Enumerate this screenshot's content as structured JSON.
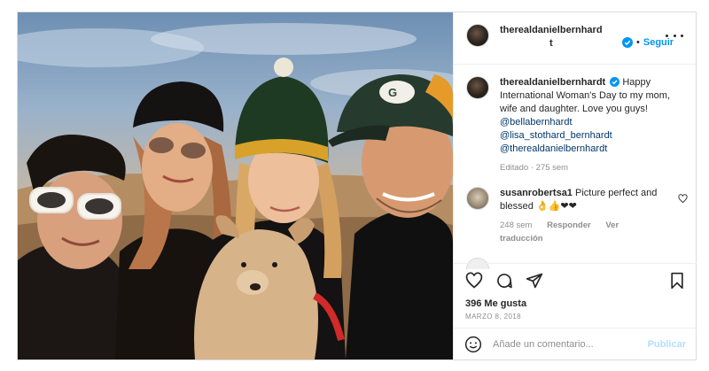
{
  "post": {
    "author": "therealdanielbernhardt",
    "author_wrapped_line1": "therealdanielbernhard",
    "author_wrapped_line2": "t",
    "follow_label": "Seguir",
    "dot": "•"
  },
  "caption": {
    "author": "therealdanielbernhardt",
    "text": " Happy International Woman's Day to my mom, wife and daughter. Love you guys! ",
    "mentions": [
      "@bellabernhardt",
      "@lisa_stothard_bernhardt",
      "@therealdanielbernhardt"
    ],
    "meta": "Editado · 275 sem"
  },
  "comment": {
    "author": "susanrobertsa1",
    "text": " Picture perfect and blessed 👌👍❤❤",
    "time": "248 sem",
    "reply_label": "Responder",
    "translate_label": "Ver traducción"
  },
  "stats": {
    "likes": "396 Me gusta",
    "date": "MARZO 8, 2018"
  },
  "add_comment": {
    "placeholder": "Añade un comentario...",
    "publish_label": "Publicar"
  },
  "icons": {
    "verified": "verified-badge-icon",
    "more": "more-options-icon",
    "like": "heart-icon",
    "comment": "comment-bubble-icon",
    "share": "paper-plane-icon",
    "save": "bookmark-icon",
    "emoji": "emoji-icon"
  },
  "colors": {
    "accent": "#0095f6",
    "mention": "#00376b",
    "muted": "#8e8e8e",
    "publish_disabled": "#b2dffc"
  }
}
